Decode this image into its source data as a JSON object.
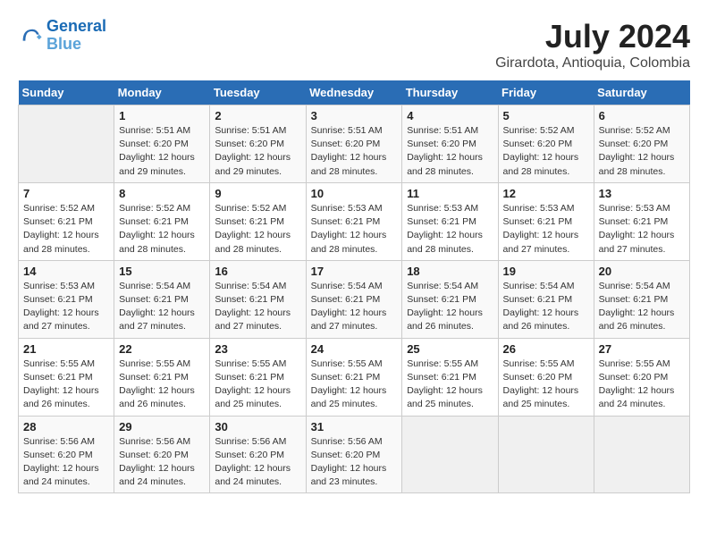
{
  "header": {
    "logo_line1": "General",
    "logo_line2": "Blue",
    "title": "July 2024",
    "subtitle": "Girardota, Antioquia, Colombia"
  },
  "weekdays": [
    "Sunday",
    "Monday",
    "Tuesday",
    "Wednesday",
    "Thursday",
    "Friday",
    "Saturday"
  ],
  "weeks": [
    [
      {
        "day": "",
        "info": ""
      },
      {
        "day": "1",
        "info": "Sunrise: 5:51 AM\nSunset: 6:20 PM\nDaylight: 12 hours\nand 29 minutes."
      },
      {
        "day": "2",
        "info": "Sunrise: 5:51 AM\nSunset: 6:20 PM\nDaylight: 12 hours\nand 29 minutes."
      },
      {
        "day": "3",
        "info": "Sunrise: 5:51 AM\nSunset: 6:20 PM\nDaylight: 12 hours\nand 28 minutes."
      },
      {
        "day": "4",
        "info": "Sunrise: 5:51 AM\nSunset: 6:20 PM\nDaylight: 12 hours\nand 28 minutes."
      },
      {
        "day": "5",
        "info": "Sunrise: 5:52 AM\nSunset: 6:20 PM\nDaylight: 12 hours\nand 28 minutes."
      },
      {
        "day": "6",
        "info": "Sunrise: 5:52 AM\nSunset: 6:20 PM\nDaylight: 12 hours\nand 28 minutes."
      }
    ],
    [
      {
        "day": "7",
        "info": "Sunrise: 5:52 AM\nSunset: 6:21 PM\nDaylight: 12 hours\nand 28 minutes."
      },
      {
        "day": "8",
        "info": "Sunrise: 5:52 AM\nSunset: 6:21 PM\nDaylight: 12 hours\nand 28 minutes."
      },
      {
        "day": "9",
        "info": "Sunrise: 5:52 AM\nSunset: 6:21 PM\nDaylight: 12 hours\nand 28 minutes."
      },
      {
        "day": "10",
        "info": "Sunrise: 5:53 AM\nSunset: 6:21 PM\nDaylight: 12 hours\nand 28 minutes."
      },
      {
        "day": "11",
        "info": "Sunrise: 5:53 AM\nSunset: 6:21 PM\nDaylight: 12 hours\nand 28 minutes."
      },
      {
        "day": "12",
        "info": "Sunrise: 5:53 AM\nSunset: 6:21 PM\nDaylight: 12 hours\nand 27 minutes."
      },
      {
        "day": "13",
        "info": "Sunrise: 5:53 AM\nSunset: 6:21 PM\nDaylight: 12 hours\nand 27 minutes."
      }
    ],
    [
      {
        "day": "14",
        "info": "Sunrise: 5:53 AM\nSunset: 6:21 PM\nDaylight: 12 hours\nand 27 minutes."
      },
      {
        "day": "15",
        "info": "Sunrise: 5:54 AM\nSunset: 6:21 PM\nDaylight: 12 hours\nand 27 minutes."
      },
      {
        "day": "16",
        "info": "Sunrise: 5:54 AM\nSunset: 6:21 PM\nDaylight: 12 hours\nand 27 minutes."
      },
      {
        "day": "17",
        "info": "Sunrise: 5:54 AM\nSunset: 6:21 PM\nDaylight: 12 hours\nand 27 minutes."
      },
      {
        "day": "18",
        "info": "Sunrise: 5:54 AM\nSunset: 6:21 PM\nDaylight: 12 hours\nand 26 minutes."
      },
      {
        "day": "19",
        "info": "Sunrise: 5:54 AM\nSunset: 6:21 PM\nDaylight: 12 hours\nand 26 minutes."
      },
      {
        "day": "20",
        "info": "Sunrise: 5:54 AM\nSunset: 6:21 PM\nDaylight: 12 hours\nand 26 minutes."
      }
    ],
    [
      {
        "day": "21",
        "info": "Sunrise: 5:55 AM\nSunset: 6:21 PM\nDaylight: 12 hours\nand 26 minutes."
      },
      {
        "day": "22",
        "info": "Sunrise: 5:55 AM\nSunset: 6:21 PM\nDaylight: 12 hours\nand 26 minutes."
      },
      {
        "day": "23",
        "info": "Sunrise: 5:55 AM\nSunset: 6:21 PM\nDaylight: 12 hours\nand 25 minutes."
      },
      {
        "day": "24",
        "info": "Sunrise: 5:55 AM\nSunset: 6:21 PM\nDaylight: 12 hours\nand 25 minutes."
      },
      {
        "day": "25",
        "info": "Sunrise: 5:55 AM\nSunset: 6:21 PM\nDaylight: 12 hours\nand 25 minutes."
      },
      {
        "day": "26",
        "info": "Sunrise: 5:55 AM\nSunset: 6:20 PM\nDaylight: 12 hours\nand 25 minutes."
      },
      {
        "day": "27",
        "info": "Sunrise: 5:55 AM\nSunset: 6:20 PM\nDaylight: 12 hours\nand 24 minutes."
      }
    ],
    [
      {
        "day": "28",
        "info": "Sunrise: 5:56 AM\nSunset: 6:20 PM\nDaylight: 12 hours\nand 24 minutes."
      },
      {
        "day": "29",
        "info": "Sunrise: 5:56 AM\nSunset: 6:20 PM\nDaylight: 12 hours\nand 24 minutes."
      },
      {
        "day": "30",
        "info": "Sunrise: 5:56 AM\nSunset: 6:20 PM\nDaylight: 12 hours\nand 24 minutes."
      },
      {
        "day": "31",
        "info": "Sunrise: 5:56 AM\nSunset: 6:20 PM\nDaylight: 12 hours\nand 23 minutes."
      },
      {
        "day": "",
        "info": ""
      },
      {
        "day": "",
        "info": ""
      },
      {
        "day": "",
        "info": ""
      }
    ]
  ]
}
